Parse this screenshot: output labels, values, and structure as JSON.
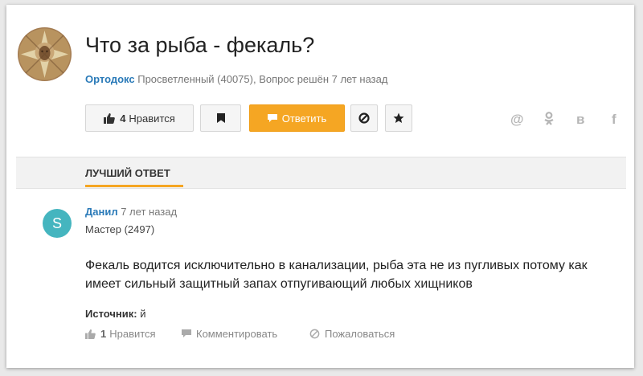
{
  "question": {
    "title": "Что за рыба - фекаль?",
    "author": "Ортодокс",
    "author_status": "Просветленный (40075), Вопрос решён 7 лет назад"
  },
  "toolbar": {
    "like_count": "4",
    "like_label": "Нравится",
    "answer_label": "Ответить"
  },
  "share": {
    "items": [
      "@",
      "ok",
      "в",
      "f"
    ]
  },
  "best_answer": {
    "section_label": "ЛУЧШИЙ ОТВЕТ",
    "avatar_letter": "S",
    "author": "Данил",
    "time": "7 лет назад",
    "rank": "Мастер (2497)",
    "text": "Фекаль водится исключительно в канализации, рыба эта не из пугливых потому как имеет сильный защитный запах отпугивающий любых хищников",
    "source_label": "Источник:",
    "source_value": "й",
    "like_count": "1",
    "like_label": "Нравится",
    "comment_label": "Комментировать",
    "report_label": "Пожаловаться"
  },
  "colors": {
    "link": "#2a7ab8",
    "accent": "#f5a623",
    "avatar_bg": "#45b5bf"
  }
}
